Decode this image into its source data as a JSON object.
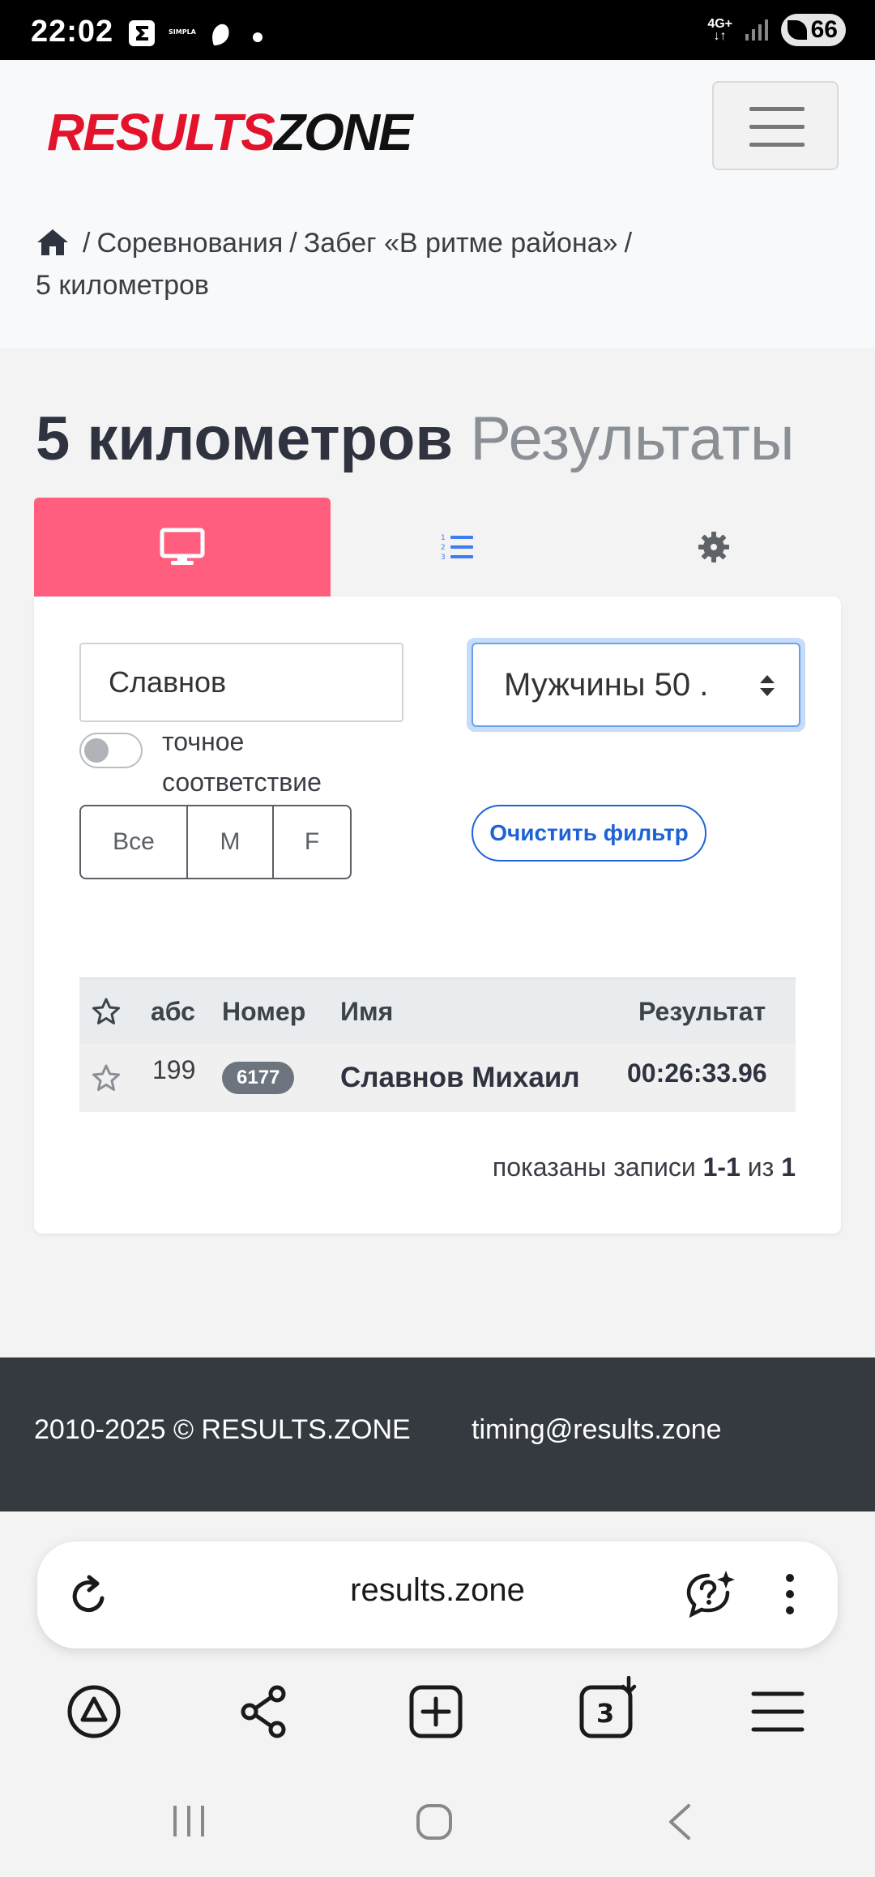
{
  "status_bar": {
    "time": "22:02",
    "network_label": "4G+",
    "battery_level": "66"
  },
  "header": {
    "logo_part1": "RESULTS",
    "logo_part2": "ZONE",
    "breadcrumb": [
      "Соревнования",
      "Забег «В ритме района»",
      "5 километров"
    ]
  },
  "page": {
    "title": "5 километров",
    "subtitle": "Результаты"
  },
  "tabs": [
    {
      "icon": "monitor-icon",
      "active": true
    },
    {
      "icon": "numbered-list-icon",
      "active": false
    },
    {
      "icon": "gear-icon",
      "active": false
    }
  ],
  "filters": {
    "search_value": "Славнов",
    "exact_match_label": "точное соответствие",
    "exact_match_on": false,
    "gender_buttons": [
      "Все",
      "M",
      "F"
    ],
    "group_select_value": "Мужчины 50 .",
    "clear_filter_label": "Очистить фильтр"
  },
  "table": {
    "columns": [
      "абс",
      "Номер",
      "Имя",
      "Результат"
    ],
    "rows": [
      {
        "place": "199",
        "bib": "6177",
        "name": "Славнов Михаил",
        "result": "00:26:33.96"
      }
    ],
    "records_prefix": "показаны записи",
    "records_range": "1-1",
    "records_of": "из",
    "records_total": "1"
  },
  "footer": {
    "copyright": "2010-2025 © RESULTS.ZONE",
    "email": "timing@results.zone"
  },
  "browser": {
    "url": "results.zone",
    "tab_count": "3"
  },
  "colors": {
    "brand_red": "#e3132c",
    "active_tab": "#ff5e7e",
    "link_blue": "#1e63d6",
    "footer_bg": "#343a40"
  }
}
